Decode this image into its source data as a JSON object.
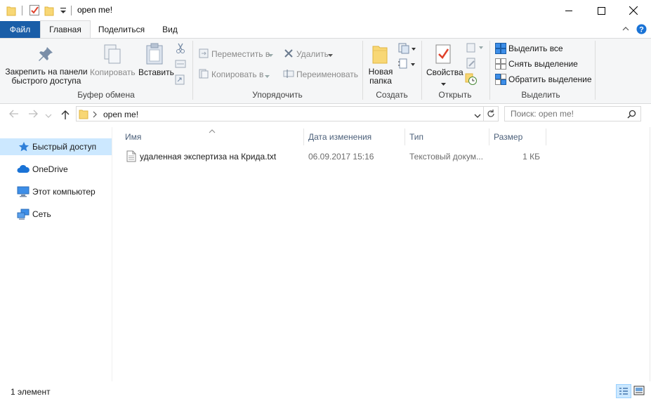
{
  "window": {
    "title": "open me!",
    "minimize_label": "Свернуть",
    "maximize_label": "Развернуть",
    "close_label": "Закрыть"
  },
  "tabs": {
    "file": "Файл",
    "home": "Главная",
    "share": "Поделиться",
    "view": "Вид"
  },
  "ribbon": {
    "clipboard": {
      "label": "Буфер обмена",
      "pin_line1": "Закрепить на панели",
      "pin_line2": "быстрого доступа",
      "copy": "Копировать",
      "paste": "Вставить"
    },
    "organize": {
      "label": "Упорядочить",
      "move_to": "Переместить в",
      "copy_to": "Копировать в",
      "delete": "Удалить",
      "rename": "Переименовать"
    },
    "new": {
      "label": "Создать",
      "new_folder_line1": "Новая",
      "new_folder_line2": "папка"
    },
    "open": {
      "label": "Открыть",
      "properties": "Свойства"
    },
    "select": {
      "label": "Выделить",
      "select_all": "Выделить все",
      "select_none": "Снять выделение",
      "invert": "Обратить выделение"
    }
  },
  "address": {
    "path": "open me!",
    "search_placeholder": "Поиск: open me!"
  },
  "nav": {
    "items": [
      {
        "label": "Быстрый доступ"
      },
      {
        "label": "OneDrive"
      },
      {
        "label": "Этот компьютер"
      },
      {
        "label": "Сеть"
      }
    ]
  },
  "columns": {
    "name": "Имя",
    "date": "Дата изменения",
    "type": "Тип",
    "size": "Размер"
  },
  "files": [
    {
      "name": "удаленная экспертиза на Крида.txt",
      "date": "06.09.2017 15:16",
      "type": "Текстовый докум...",
      "size": "1 КБ"
    }
  ],
  "status": {
    "count": "1 элемент"
  },
  "colors": {
    "accent": "#1a5ea8",
    "selection": "#cce8ff"
  }
}
